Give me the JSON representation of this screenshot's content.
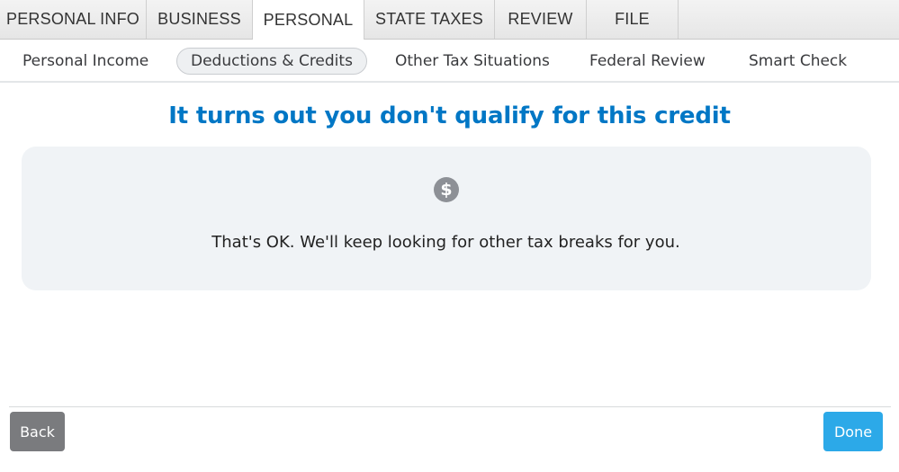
{
  "top_tabs": [
    {
      "label": "PERSONAL INFO",
      "active": false
    },
    {
      "label": "BUSINESS",
      "active": false
    },
    {
      "label": "PERSONAL",
      "active": true
    },
    {
      "label": "STATE TAXES",
      "active": false
    },
    {
      "label": "REVIEW",
      "active": false
    },
    {
      "label": "FILE",
      "active": false
    }
  ],
  "sub_nav": [
    {
      "label": "Personal Income",
      "active": false
    },
    {
      "label": "Deductions & Credits",
      "active": true
    },
    {
      "label": "Other Tax Situations",
      "active": false
    },
    {
      "label": "Federal Review",
      "active": false
    },
    {
      "label": "Smart Check",
      "active": false
    }
  ],
  "main": {
    "headline": "It turns out you don't qualify for this credit",
    "card_icon": "dollar-circle-icon",
    "card_icon_glyph": "$",
    "card_message": "That's OK. We'll keep looking for other tax breaks for you."
  },
  "footer": {
    "back_label": "Back",
    "done_label": "Done"
  },
  "colors": {
    "headline": "#0077c5",
    "card_background": "#f0f3f6",
    "back_button": "#7a7b7e",
    "done_button": "#2ca9e8"
  }
}
